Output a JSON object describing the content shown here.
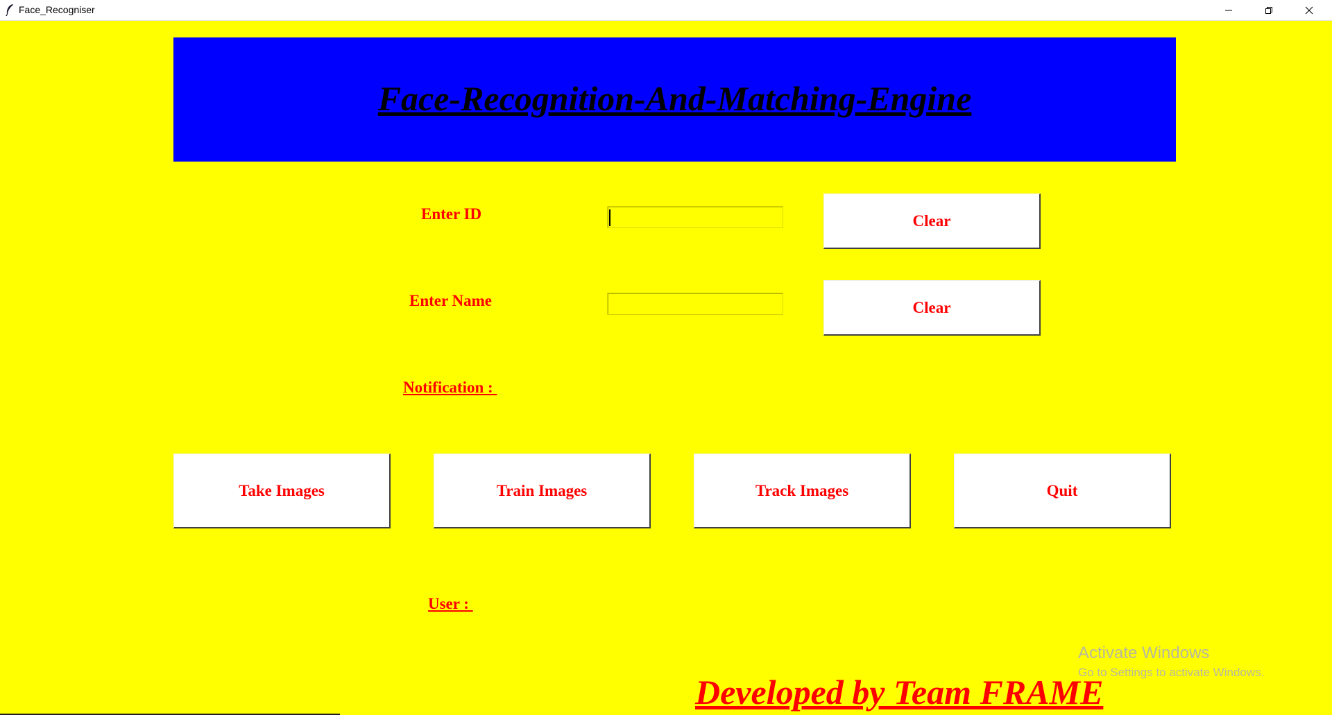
{
  "window": {
    "title": "Face_Recogniser",
    "controls": {
      "minimize": "minimize-icon",
      "maximize": "restore-icon",
      "close": "close-icon"
    }
  },
  "header": {
    "title": "Face-Recognition-And-Matching-Engine"
  },
  "form": {
    "id_label": "Enter ID",
    "id_value": "",
    "name_label": "Enter Name",
    "name_value": "",
    "clear_id_label": "Clear",
    "clear_name_label": "Clear",
    "notification_label": "Notification : "
  },
  "actions": {
    "take_images": "Take Images",
    "train_images": "Train Images",
    "track_images": "Track Images",
    "quit": "Quit"
  },
  "user_label": "User : ",
  "footer": "Developed by Team FRAME",
  "watermark": {
    "line1": "Activate Windows",
    "line2": "Go to Settings to activate Windows."
  },
  "colors": {
    "background": "#ffff00",
    "banner": "#0000ff",
    "label_text": "#ff0000",
    "button_bg": "#ffffff"
  }
}
